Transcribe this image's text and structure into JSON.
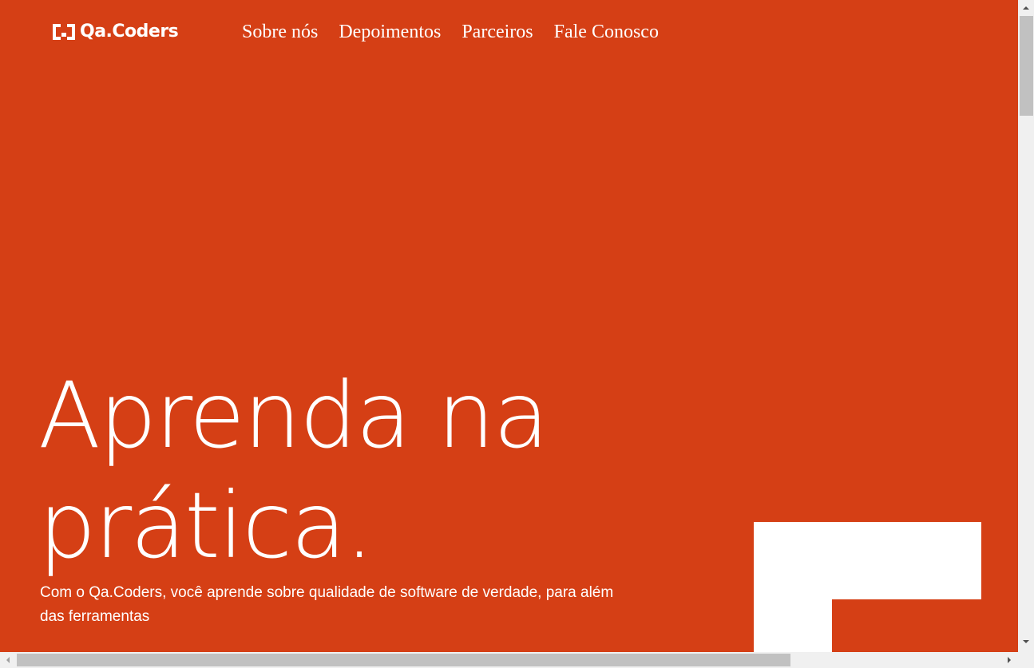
{
  "brand": {
    "logo_text": "Qa.Coders",
    "background_color": "#d53f15",
    "text_color": "#ffffff"
  },
  "nav": {
    "items": [
      {
        "label": "Sobre nós"
      },
      {
        "label": "Depoimentos"
      },
      {
        "label": "Parceiros"
      },
      {
        "label": "Fale Conosco"
      }
    ]
  },
  "hero": {
    "title_line1": "Aprenda na",
    "title_line2": "prática.",
    "subtitle": "Com o Qa.Coders, você aprende sobre qualidade de software de verdade, para além das ferramentas"
  },
  "icons": {
    "logo_mark": "bracket-logo-icon",
    "scroll_up": "chevron-up-icon",
    "scroll_down": "chevron-down-icon",
    "scroll_left": "chevron-left-icon",
    "scroll_right": "chevron-right-icon"
  }
}
